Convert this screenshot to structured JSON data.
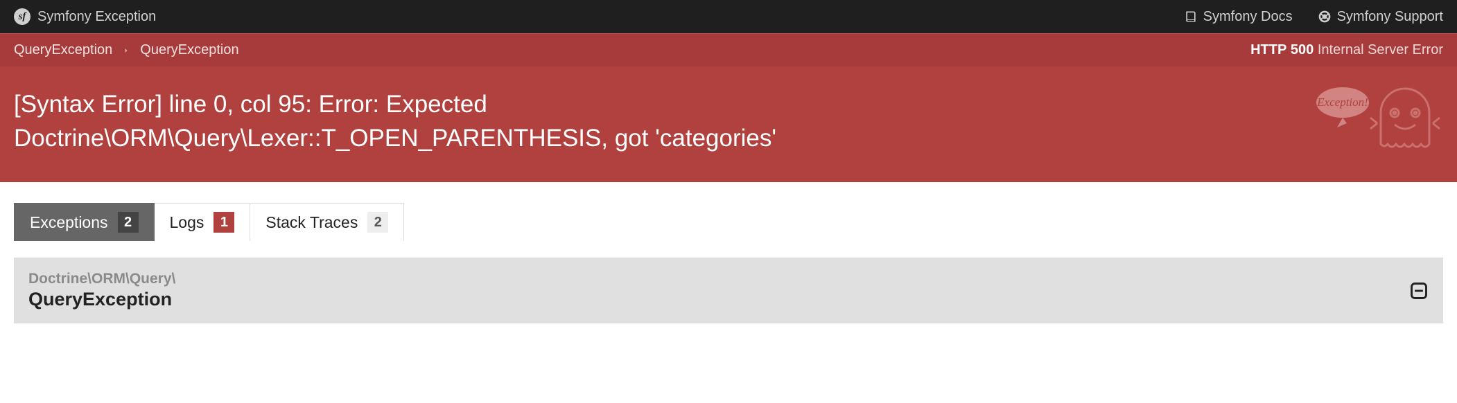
{
  "top": {
    "title": "Symfony Exception",
    "docs_label": "Symfony Docs",
    "support_label": "Symfony Support"
  },
  "breadcrumb": {
    "items": [
      "QueryException",
      "QueryException"
    ],
    "http_prefix": "HTTP",
    "http_code": "500",
    "http_text": "Internal Server Error"
  },
  "hero": {
    "title": "[Syntax Error] line 0, col 95: Error: Expected Doctrine\\ORM\\Query\\Lexer::T_OPEN_PAREN­THESIS, got 'categories'",
    "ghost_bubble": "Exception!"
  },
  "tabs": [
    {
      "label": "Exceptions",
      "count": "2",
      "active": true,
      "badge_style": "default"
    },
    {
      "label": "Logs",
      "count": "1",
      "active": false,
      "badge_style": "error"
    },
    {
      "label": "Stack Traces",
      "count": "2",
      "active": false,
      "badge_style": "default"
    }
  ],
  "panel": {
    "namespace": "Doctrine\\ORM\\Query\\",
    "name": "QueryException"
  }
}
